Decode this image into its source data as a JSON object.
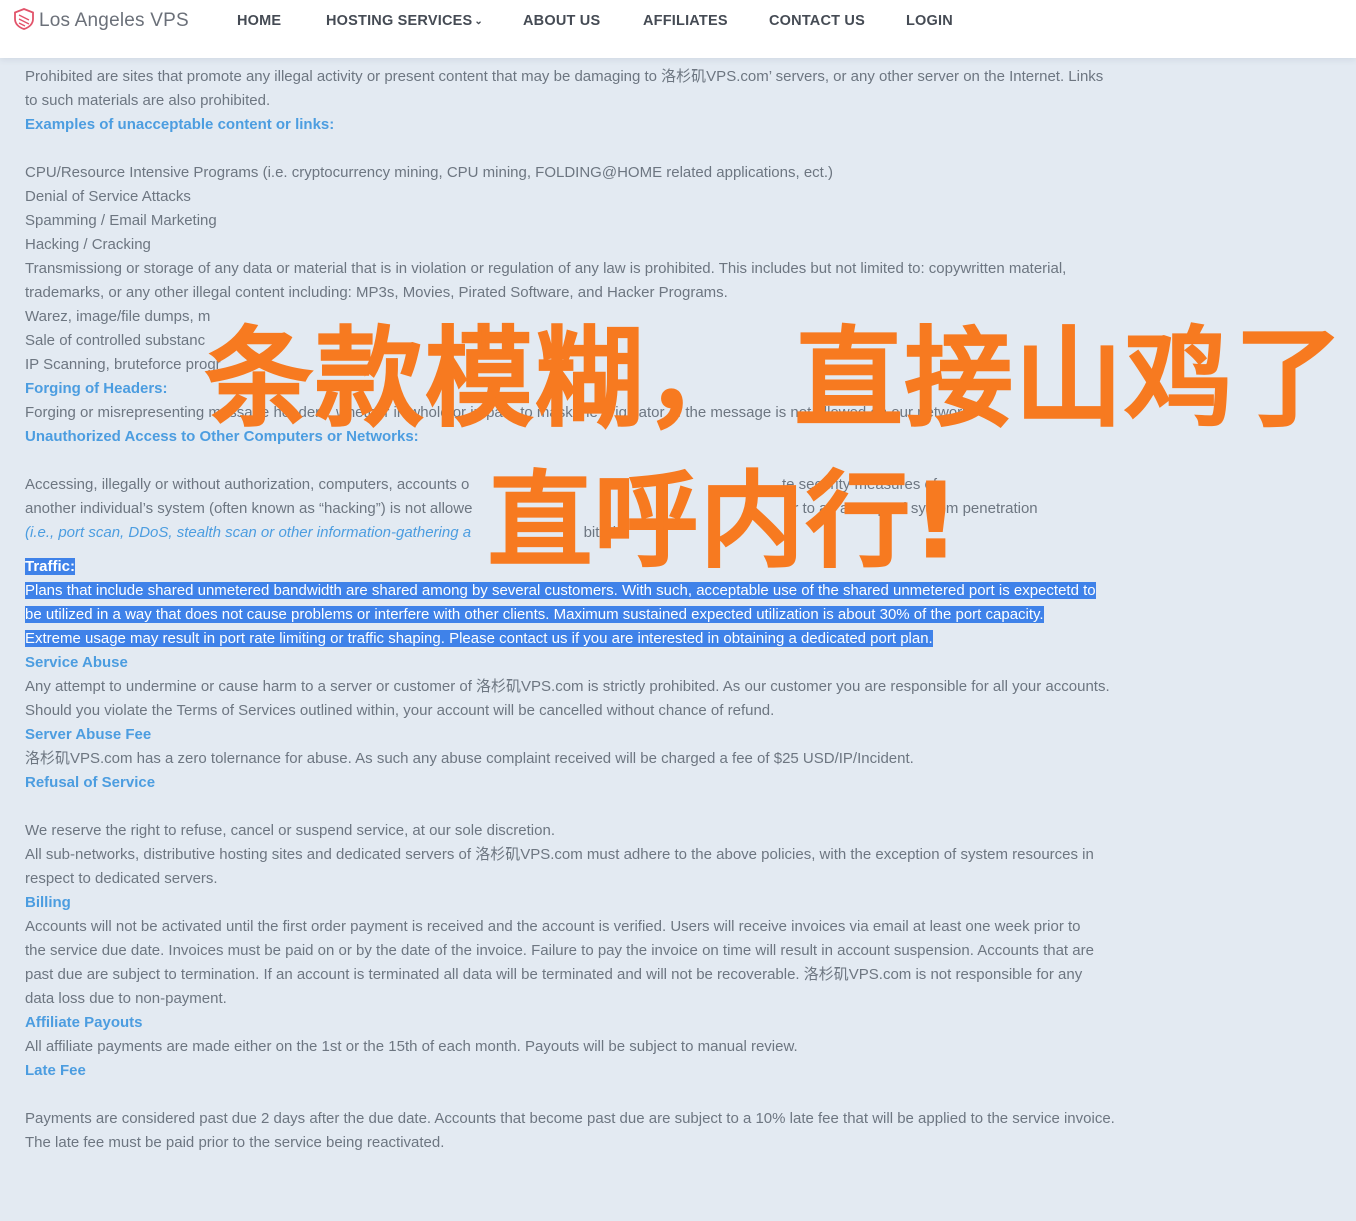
{
  "brand": {
    "name": "Los Angeles VPS",
    "logo_icon": "shield-logo-icon"
  },
  "nav": {
    "items": [
      {
        "label": "HOME"
      },
      {
        "label": "HOSTING SERVICES",
        "dropdown": true
      },
      {
        "label": "ABOUT US"
      },
      {
        "label": "AFFILIATES"
      },
      {
        "label": "CONTACT US"
      },
      {
        "label": "LOGIN"
      }
    ],
    "chevron_icon": "chevron-down-icon"
  },
  "content": {
    "intro_line1": "Prohibited are sites that promote any illegal activity or present content that may be damaging to 洛杉矶VPS.com’ servers, or any other server on the Internet. Links",
    "intro_line2": "to such materials are also prohibited.",
    "examples_heading": "Examples of unacceptable content or links:",
    "examples": [
      "CPU/Resource Intensive Programs (i.e. cryptocurrency mining, CPU mining, FOLDING@HOME related applications, ect.)",
      "Denial of Service Attacks",
      "Spamming / Email Marketing",
      "Hacking / Cracking",
      "Transmissiong or storage of any data or material that is in violation or regulation of any law is prohibited. This includes but not limited to: copywritten material,",
      "trademarks, or any other illegal content including: MP3s, Movies, Pirated Software, and Hacker Programs.",
      "Warez, image/file dumps, m",
      "Sale of controlled substanc",
      "IP Scanning, bruteforce progr"
    ],
    "forging_heading": "Forging of Headers:",
    "forging_text": "Forging or misrepresenting message headers, whether in whole or in part, to mask the originator of the message is not allowed on our network.",
    "unauth_heading": "Unauthorized Access to Other Computers or Networks:",
    "unauth_line1": "Accessing, illegally or without authorization, computers, accounts o                                                                           te security measures of",
    "unauth_line2": "another individual’s system (often known as “hacking”) is not allowe                                                                             r to an attempted system penetration",
    "unauth_line3_link": "(i.e., port scan, DDoS, stealth scan or other information-gathering a",
    "unauth_line3_rest": "                           bited.",
    "traffic_heading": "Traffic:",
    "traffic_line1": "Plans that include shared unmetered bandwidth are shared among by several customers. With such, acceptable use of the shared unmetered port is expectetd to",
    "traffic_line2": "be utilized in a way that does not cause problems or interfere with other clients. Maximum sustained expected utilization is about 30% of the port capacity.",
    "traffic_line3": "Extreme usage may result in port rate limiting or traffic shaping. Please contact us if you are interested in obtaining a dedicated port plan.",
    "service_abuse_heading": "Service Abuse",
    "service_abuse_line1": "Any attempt to undermine or cause harm to a server or customer of 洛杉矶VPS.com is strictly prohibited. As our customer you are responsible for all your accounts.",
    "service_abuse_line2": "Should you violate the Terms of Services outlined within, your account will be cancelled without chance of refund.",
    "server_fee_heading": "Server Abuse Fee",
    "server_fee_text": "洛杉矶VPS.com has a zero tolernance for abuse. As such any abuse complaint received will be charged a fee of $25 USD/IP/Incident.",
    "refusal_heading": "Refusal of Service",
    "refusal_line1": "We reserve the right to refuse, cancel or suspend service, at our sole discretion.",
    "refusal_line2": "All sub-networks, distributive hosting sites and dedicated servers of 洛杉矶VPS.com must adhere to the above policies, with the exception of system resources in",
    "refusal_line3": "respect to dedicated servers.",
    "billing_heading": "Billing",
    "billing_line1": "Accounts will not be activated until the first order payment is received and the account is verified. Users will receive invoices via email at least one week prior to",
    "billing_line2": "the service due date. Invoices must be paid on or by the date of the invoice. Failure to pay the invoice on time will result in account suspension. Accounts that are",
    "billing_line3": "past due are subject to termination. If an account is terminated all data will be terminated and will not be recoverable. 洛杉矶VPS.com is not responsible for any",
    "billing_line4": "data loss due to non-payment.",
    "affiliate_heading": "Affiliate Payouts",
    "affiliate_text": "All affiliate payments are made either on the 1st or the 15th of each month. Payouts will be subject to manual review.",
    "late_heading": "Late Fee",
    "late_line1": "Payments are considered past due 2 days after the due date. Accounts that become past due are subject to a 10% late fee that will be applied to the service invoice.",
    "late_line2": "The late fee must be paid prior to the service being reactivated."
  },
  "overlay": {
    "line1": "条款模糊， 直接山鸡了",
    "line2": "直呼内行!",
    "color": "#f77a20"
  },
  "colors": {
    "background": "#e3eaf2",
    "heading": "#4c9de0",
    "selection": "#3f82e9",
    "navbar": "#ffffff"
  }
}
